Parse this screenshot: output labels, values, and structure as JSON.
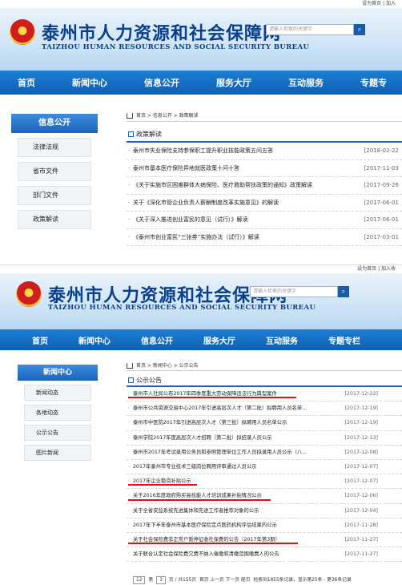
{
  "page1": {
    "topbar": "设为首页 | 加入",
    "site_title": "泰州市人力资源和社会保障网",
    "site_title_en": "TAIZHOU HUMAN RESOURCES AND SOCIAL SECURITY BUREAU",
    "search_placeholder": "请输入检索的关键字",
    "nav": [
      "首页",
      "新闻中心",
      "信息公开",
      "服务大厅",
      "互动服务",
      "专题专"
    ],
    "sidebar_title": "信息公开",
    "sidebar_items": [
      "法律法规",
      "省市文件",
      "部门文件",
      "政策解读"
    ],
    "breadcrumb": "首页 > 信息公开 > 政策解读",
    "section_title": "政策解读",
    "rows": [
      {
        "title": "泰州市失业保险支持参保职工提升职业技能政策五问五答",
        "date": "[2018-02-22"
      },
      {
        "title": "泰州市基本医疗保险异地就医政策十问十答",
        "date": "[2017-11-03"
      },
      {
        "title": "《关于实施市区困难群体大病保险、医疗救助帮扶政策的通知》政策解读",
        "date": "[2017-09-26"
      },
      {
        "title": "关于《深化市管企业负责人薪酬制度改革实施意见》的解读",
        "date": "[2017-06-01"
      },
      {
        "title": "《关于深入推进创业富民的意见（试行）》解读",
        "date": "[2017-06-01"
      },
      {
        "title": "《泰州市创业富民“三张券”实施办法（试行）》解读",
        "date": "[2017-03-01"
      }
    ]
  },
  "page2": {
    "topbar": "设为首页 | 加入收",
    "site_title": "泰州市人力资源和社会保障网",
    "site_title_en": "TAIZHOU HUMAN RESOURCES AND SOCIAL SECURITY BUREAU",
    "search_placeholder": "请输入检索的关键字",
    "nav": [
      "首页",
      "新闻中心",
      "信息公开",
      "服务大厅",
      "互动服务",
      "专题专栏"
    ],
    "sidebar_title": "新闻中心",
    "sidebar_items": [
      "新闻动态",
      "各地动态",
      "公示公告",
      "图片新闻"
    ],
    "breadcrumb": "首页 > 新闻中心 > 公示公告",
    "section_title": "公示公告",
    "rows": [
      {
        "title": "泰州市人社局公布2017年四季度重大劳动保障违法行为典型案件",
        "date": "[2017-12-22]"
      },
      {
        "title": "泰州市公共资源交易中心2017年引进高层次人才（第二批）拟聘用人员名单...",
        "date": "[2017-12-19]"
      },
      {
        "title": "泰州市中医院2017年引进高层次人才（第三批）拟聘用人员名单公示",
        "date": "[2017-12-19]"
      },
      {
        "title": "泰州学院2017年度高层次人才招聘（第二批）拟招录人员公示",
        "date": "[2017-12-13]"
      },
      {
        "title": "泰州市2017年考试录用公务员和参照管理单位工作人员拟录用人员公示（八...",
        "date": "[2017-12-08]"
      },
      {
        "title": "2017年泰州市专业技术三级岗位聘用评审通过人员公示",
        "date": "[2017-12-07]"
      },
      {
        "title": "2017年企业稳岗补贴公示",
        "date": "[2017-12-07]"
      },
      {
        "title": "关于2016年度政府购买高技能人才培训成果补贴情况公示",
        "date": "[2017-12-06]"
      },
      {
        "title": "关于全省安监系统先进集体和先进工作者推荐对象的公示",
        "date": "[2017-12-04]"
      },
      {
        "title": "2017年下半年泰州市基本医疗保险定点医药机构评估结果的公示",
        "date": "[2017-11-28]"
      },
      {
        "title": "关于社会保险费非正常户暂停征收社保费的公告（2017年第3期）",
        "date": "[2017-11-27]"
      },
      {
        "title": "关于联合认定社会保险费欠费不纳入催缴和清缴范围缴费人的公告",
        "date": "[2017-11-27]"
      }
    ],
    "pager": {
      "page_size": "12",
      "first": "第",
      "current": "3",
      "total": "页 / 共155页",
      "nav": "首页  上一页  下一页  尾页",
      "summary": "检索到1855条记录，显示第25条 - 第36条记录"
    }
  }
}
